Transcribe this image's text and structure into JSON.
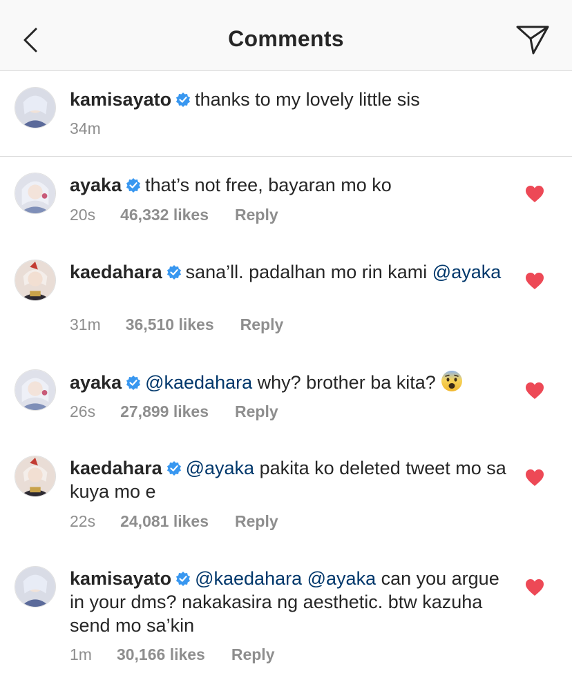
{
  "header": {
    "title": "Comments",
    "back_icon": "chevron-left-icon",
    "send_icon": "paper-plane-icon"
  },
  "colors": {
    "heart": "#ed4956",
    "verified": "#3897f0",
    "mention": "#00376b",
    "meta": "#8e8e8e"
  },
  "caption": {
    "username": "kamisayato",
    "text": "thanks to my lovely little sis",
    "time": "34m"
  },
  "comments": [
    {
      "username": "ayaka",
      "parts": [
        {
          "t": "that’s not free, bayaran mo ko",
          "m": false
        }
      ],
      "time": "20s",
      "likes": "46,332 likes",
      "reply": "Reply"
    },
    {
      "username": "kaedahara",
      "parts": [
        {
          "t": "sana’ll. padalhan mo rin kami ",
          "m": false
        },
        {
          "t": "@ayaka",
          "m": true
        }
      ],
      "time": "31m",
      "likes": "36,510 likes",
      "reply": "Reply"
    },
    {
      "username": "ayaka",
      "parts": [
        {
          "t": "@kaedahara",
          "m": true
        },
        {
          "t": " why? brother ba kita?",
          "m": false
        }
      ],
      "emoji": "fearful-face-emoji",
      "time": "26s",
      "likes": "27,899 likes",
      "reply": "Reply"
    },
    {
      "username": "kaedahara",
      "parts": [
        {
          "t": "@ayaka",
          "m": true
        },
        {
          "t": " pakita ko deleted tweet mo sa kuya mo e",
          "m": false
        }
      ],
      "time": "22s",
      "likes": "24,081 likes",
      "reply": "Reply"
    },
    {
      "username": "kamisayato",
      "parts": [
        {
          "t": "@kaedahara",
          "m": true
        },
        {
          "t": " ",
          "m": false
        },
        {
          "t": "@ayaka",
          "m": true
        },
        {
          "t": " can you argue in your dms? nakakasira ng aesthetic. btw kazuha send mo sa’kin",
          "m": false
        }
      ],
      "time": "1m",
      "likes": "30,166 likes",
      "reply": "Reply"
    }
  ]
}
